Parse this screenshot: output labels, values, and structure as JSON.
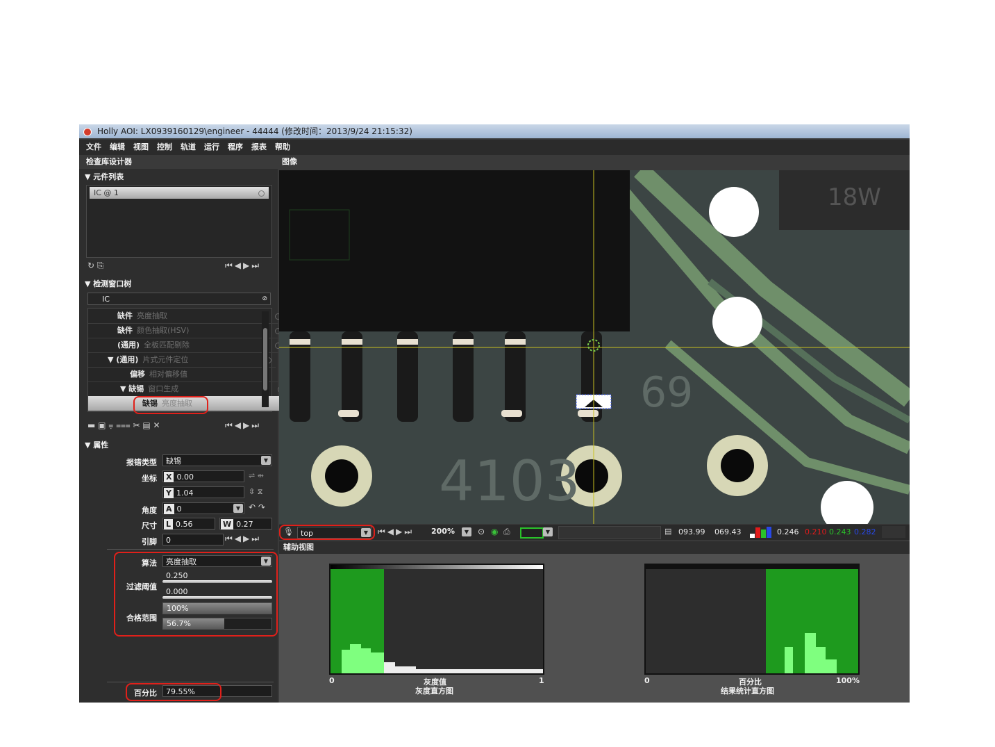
{
  "window": {
    "title": "Holly AOI: LX0939160129\\engineer - 44444 (修改时间：2013/9/24 21:15:32)"
  },
  "menu": [
    "文件",
    "编辑",
    "视图",
    "控制",
    "轨道",
    "运行",
    "程序",
    "报表",
    "帮助"
  ],
  "left_header": "检查库设计器",
  "image_header": "图像",
  "component_list": {
    "title": "▼ 元件列表",
    "items": [
      "IC  @ 1"
    ]
  },
  "window_tree": {
    "title": "▼ 检测窗口树",
    "root": "IC",
    "rows": [
      {
        "type": "缺件",
        "algo": "亮度抽取"
      },
      {
        "type": "缺件",
        "algo": "颜色抽取(HSV)"
      },
      {
        "type": "(通用)",
        "algo": "全板匹配剔除"
      },
      {
        "type": "▼ (通用)",
        "algo": "片式元件定位"
      },
      {
        "type": "偏移",
        "algo": "相对偏移值"
      },
      {
        "type": "▼ 缺锡",
        "algo": "窗口生成"
      },
      {
        "type": "缺锡",
        "algo": "亮度抽取"
      }
    ]
  },
  "properties": {
    "title": "▼ 属性",
    "error_type_label": "报错类型",
    "error_type_value": "缺锡",
    "coord_label": "坐标",
    "x_value": "0.00",
    "y_value": "1.04",
    "angle_label": "角度",
    "angle_value": "0",
    "size_label": "尺寸",
    "l_value": "0.56",
    "w_value": "0.27",
    "pin_label": "引脚",
    "pin_value": "0",
    "algorithm_label": "算法",
    "algorithm_value": "亮度抽取",
    "filter_label": "过滤阈值",
    "filter_high": "0.250",
    "filter_low": "0.000",
    "pass_label": "合格范围",
    "pass_high": "100%",
    "pass_low": "56.7%",
    "pass_low_fraction": 0.567,
    "percent_label": "百分比",
    "percent_value": "79.55%"
  },
  "image_toolbar": {
    "view_select": "top",
    "zoom": "200%",
    "coord_x": "093.99",
    "coord_y": "069.43",
    "gray": "0.246",
    "r": "0.210",
    "g": "0.243",
    "b": "0.282"
  },
  "aux_view": {
    "title": "辅助视图",
    "hist1": {
      "x_min": "0",
      "x_max": "1",
      "xlabel": "灰度值",
      "title": "灰度直方图"
    },
    "hist2": {
      "x_min": "0",
      "x_max": "100%",
      "xlabel": "百分比",
      "title": "结果统计直方图"
    }
  },
  "colors": {
    "highlight": "#e0201a",
    "histogram_green": "#1e9a1e",
    "histogram_light_green": "#7fff7f"
  }
}
